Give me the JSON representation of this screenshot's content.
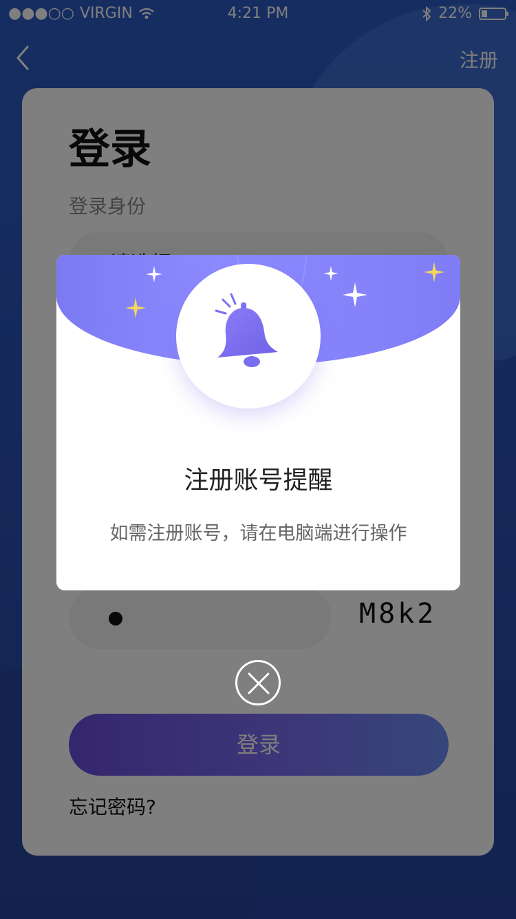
{
  "status_bar": {
    "signal_dots": "●●●○○",
    "carrier": "VIRGIN",
    "time": "4:21 PM",
    "battery_text": "22%",
    "battery_level": 0.22
  },
  "nav": {
    "back_icon": "chevron-left-icon",
    "register_label": "注册"
  },
  "login_card": {
    "title": "登录",
    "identity_label": "登录身份",
    "identity_placeholder": "请选择",
    "code_value": "●",
    "captcha_text": "M8k2",
    "login_button": "登录",
    "forgot_password": "忘记密码?"
  },
  "modal": {
    "icon": "bell-icon",
    "title": "注册账号提醒",
    "message": "如需注册账号，请在电脑端进行操作",
    "close_icon": "close-icon",
    "accent_color": "#7f7cf6",
    "star_color": "#f5d55a"
  }
}
